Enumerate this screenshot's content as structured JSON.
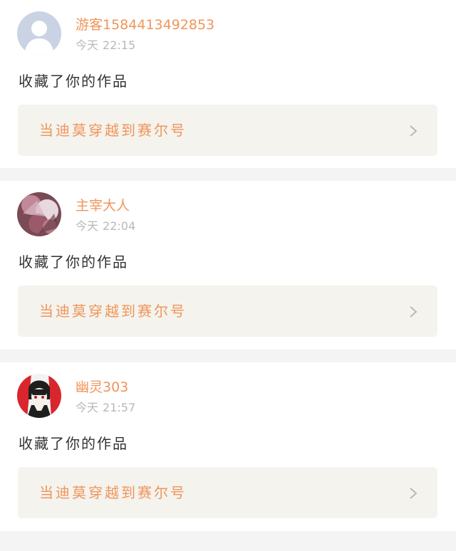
{
  "feed": [
    {
      "username": "游客1584413492853",
      "day": "今天",
      "time": "22:15",
      "action": "收藏了你的作品",
      "work_title": "当迪莫穿越到赛尔号",
      "avatar": "default-user-icon"
    },
    {
      "username": "主宰大人",
      "day": "今天",
      "time": "22:04",
      "action": "收藏了你的作品",
      "work_title": "当迪莫穿越到赛尔号",
      "avatar": "anime-art-avatar"
    },
    {
      "username": "幽灵303",
      "day": "今天",
      "time": "21:57",
      "action": "收藏了你的作品",
      "work_title": "当迪莫穿越到赛尔号",
      "avatar": "anime-character-avatar"
    }
  ],
  "colors": {
    "accent": "#f0955a",
    "time": "#b8b8b8",
    "text": "#333333",
    "link_bg": "#f4f3ee",
    "page_bg": "#f4f4f4"
  }
}
